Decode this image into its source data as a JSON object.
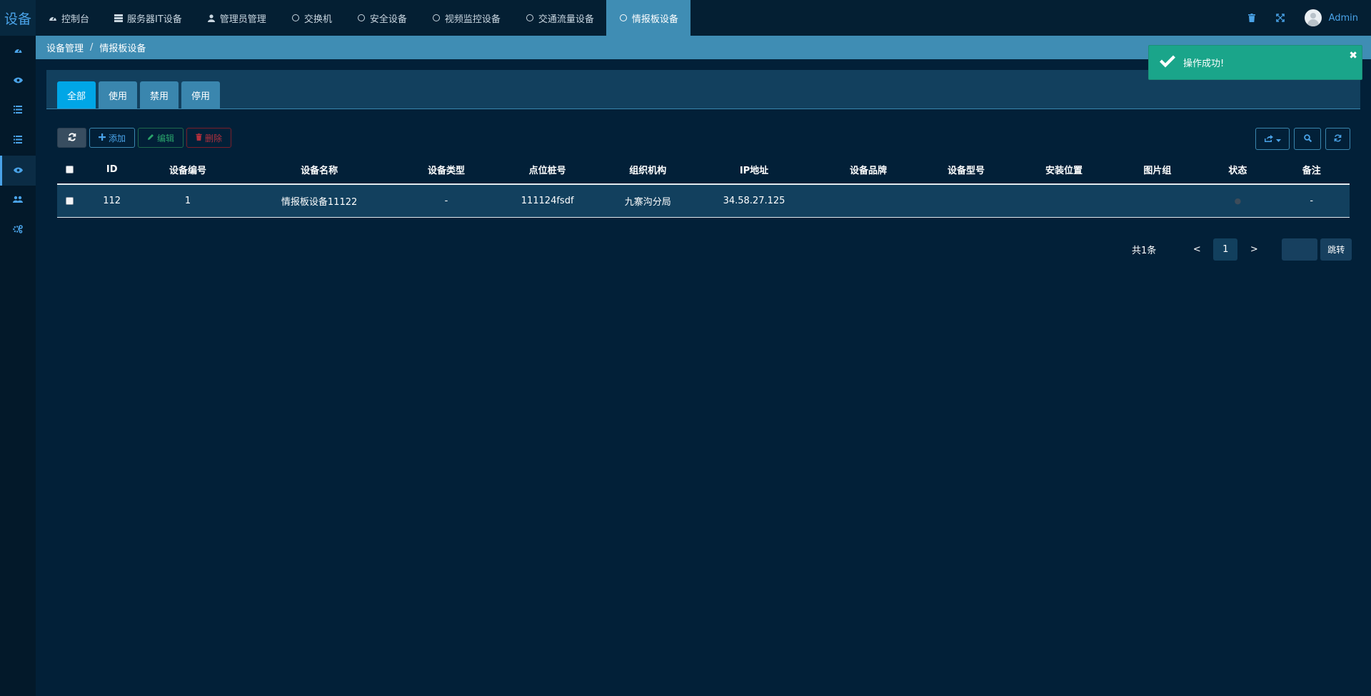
{
  "brand": "设备",
  "nav": {
    "tabs": [
      {
        "label": "控制台",
        "icon": "dashboard-icon"
      },
      {
        "label": "服务器IT设备",
        "icon": "server-icon"
      },
      {
        "label": "管理员管理",
        "icon": "user-icon"
      },
      {
        "label": "交换机",
        "icon": "circle-icon"
      },
      {
        "label": "安全设备",
        "icon": "circle-icon"
      },
      {
        "label": "视频监控设备",
        "icon": "circle-icon"
      },
      {
        "label": "交通流量设备",
        "icon": "circle-icon"
      },
      {
        "label": "情报板设备",
        "icon": "circle-icon",
        "active": true
      }
    ],
    "user": "Admin"
  },
  "sidebar": {
    "items": [
      {
        "icon": "dashboard-icon"
      },
      {
        "icon": "eye-icon"
      },
      {
        "icon": "list-icon"
      },
      {
        "icon": "list-icon"
      },
      {
        "icon": "eye-icon",
        "active": true
      },
      {
        "icon": "users-icon"
      },
      {
        "icon": "cogs-icon"
      }
    ]
  },
  "breadcrumb": {
    "parent": "设备管理",
    "separator": "/",
    "current": "情报板设备"
  },
  "status_tabs": [
    "全部",
    "使用",
    "禁用",
    "停用"
  ],
  "toolbar": {
    "add_label": "添加",
    "edit_label": "编辑",
    "delete_label": "删除"
  },
  "table": {
    "columns": [
      "ID",
      "设备编号",
      "设备名称",
      "设备类型",
      "点位桩号",
      "组织机构",
      "IP地址",
      "设备品牌",
      "设备型号",
      "安装位置",
      "图片组",
      "状态",
      "备注"
    ],
    "rows": [
      {
        "id": "112",
        "code": "1",
        "name": "情报板设备11122",
        "type": "-",
        "pile": "111124fsdf",
        "org": "九寨沟分局",
        "ip": "34.58.27.125",
        "brand": "",
        "model": "",
        "location": "",
        "images": "",
        "status": "",
        "remark": "-"
      }
    ]
  },
  "pagination": {
    "total": "共1条",
    "prev": "<",
    "page": "1",
    "next": ">",
    "go": "跳转"
  },
  "toast": {
    "message": "操作成功!",
    "close": "✖"
  },
  "colors": {
    "background": "#022038",
    "accent": "#3f8db4",
    "tab_active": "#00a6e6",
    "toast": "#1aa58a"
  }
}
